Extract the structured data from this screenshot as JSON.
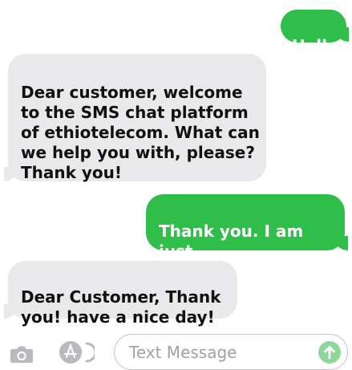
{
  "messages": [
    {
      "direction": "outgoing",
      "text": "Hello"
    },
    {
      "direction": "incoming",
      "text": "Dear customer, welcome\nto the SMS chat platform\nof ethiotelecom. What can\nwe help you with, please?\nThank you!"
    },
    {
      "direction": "outgoing",
      "text": "Thank you. I am just\ntesting."
    },
    {
      "direction": "incoming",
      "text": "Dear Customer,  Thank\nyou! have a nice day!"
    }
  ],
  "composer": {
    "placeholder": "Text Message",
    "camera_icon": "camera-icon",
    "apps_icon": "app-store-icon",
    "send_icon": "send-arrow-icon"
  },
  "colors": {
    "outgoing_bubble": "#2fbe49",
    "incoming_bubble": "#e9e9eb",
    "send_button_disabled": "#8fd69a"
  }
}
